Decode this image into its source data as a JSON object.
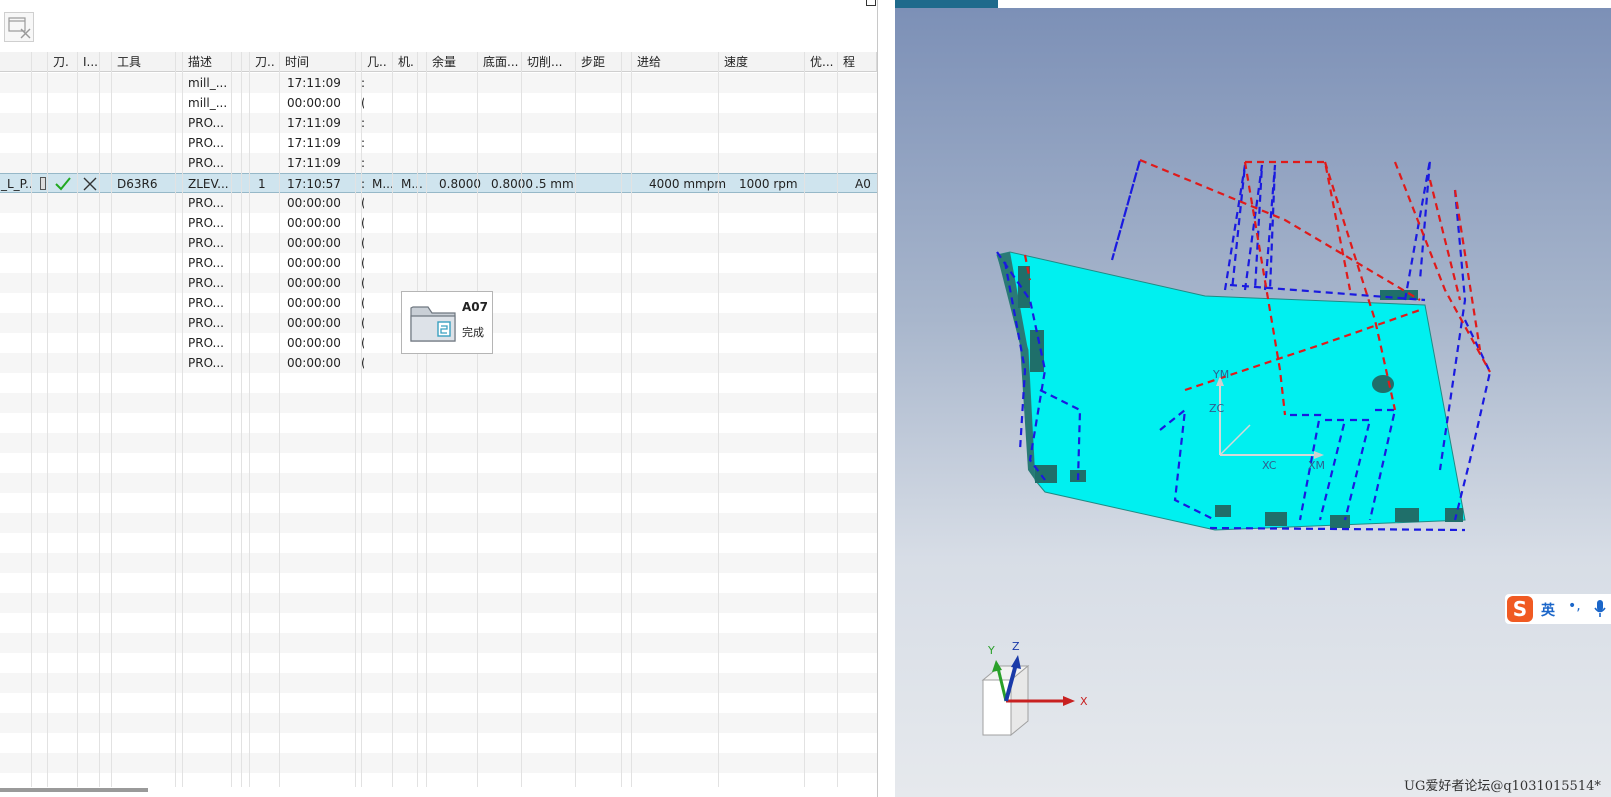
{
  "columns": [
    "",
    "",
    "刀.",
    "I...",
    "",
    "工具",
    "",
    "描述",
    "",
    "",
    "刀..",
    "时间",
    "",
    "几..",
    "机.",
    "",
    "余量",
    "底面...",
    "切削...",
    "步距",
    "",
    "进给",
    "速度",
    "优...",
    "程"
  ],
  "rows": [
    {
      "desc": "mill_...",
      "time": "17:11:09",
      "flag": ":"
    },
    {
      "desc": "mill_...",
      "time": "00:00:00",
      "flag": "("
    },
    {
      "desc": "PRO...",
      "time": "17:11:09",
      "flag": ":"
    },
    {
      "desc": "PRO...",
      "time": "17:11:09",
      "flag": ":"
    },
    {
      "desc": "PRO...",
      "time": "17:11:09",
      "flag": ":"
    },
    {
      "selected": true,
      "name": "_L_P...",
      "tool": "D63R6",
      "desc": "ZLEV...",
      "tool_no": "1",
      "time": "17:10:57",
      "flag": ":",
      "geom": "M...",
      "machine": "M...",
      "stock": "0.8000",
      "floor_stock": "0.8000",
      "cut": ".5 mm",
      "feed": "4000 mmpm",
      "speed": "1000 rpm",
      "program": "A0"
    },
    {
      "desc": "PRO...",
      "time": "00:00:00",
      "flag": "("
    },
    {
      "desc": "PRO...",
      "time": "00:00:00",
      "flag": "("
    },
    {
      "desc": "PRO...",
      "time": "00:00:00",
      "flag": "("
    },
    {
      "desc": "PRO...",
      "time": "00:00:00",
      "flag": "("
    },
    {
      "desc": "PRO...",
      "time": "00:00:00",
      "flag": "("
    },
    {
      "desc": "PRO...",
      "time": "00:00:00",
      "flag": "("
    },
    {
      "desc": "PRO...",
      "time": "00:00:00",
      "flag": "("
    },
    {
      "desc": "PRO...",
      "time": "00:00:00",
      "flag": "("
    },
    {
      "desc": "PRO...",
      "time": "00:00:00",
      "flag": "("
    }
  ],
  "tooltip": {
    "name": "A07",
    "status": "完成"
  },
  "viewport": {
    "wcs_labels": {
      "y": "YM",
      "z": "ZC",
      "xc": "XC",
      "xm": "XM"
    },
    "triad": {
      "x": "X",
      "y": "Y",
      "z": "Z"
    },
    "part_color": "#00f0f0",
    "toolpath_colors": {
      "blue": "#1a1ae0",
      "red": "#e01a1a"
    }
  },
  "ime": {
    "logo": "S",
    "lang": "英",
    "punct": "•,"
  },
  "watermark": "UG爱好者论坛@q1031015514*",
  "icons": {
    "toolbar": "window-close-icon",
    "check": "check-icon",
    "cross": "cross-icon",
    "folder": "folder-icon",
    "mic": "microphone-icon"
  }
}
